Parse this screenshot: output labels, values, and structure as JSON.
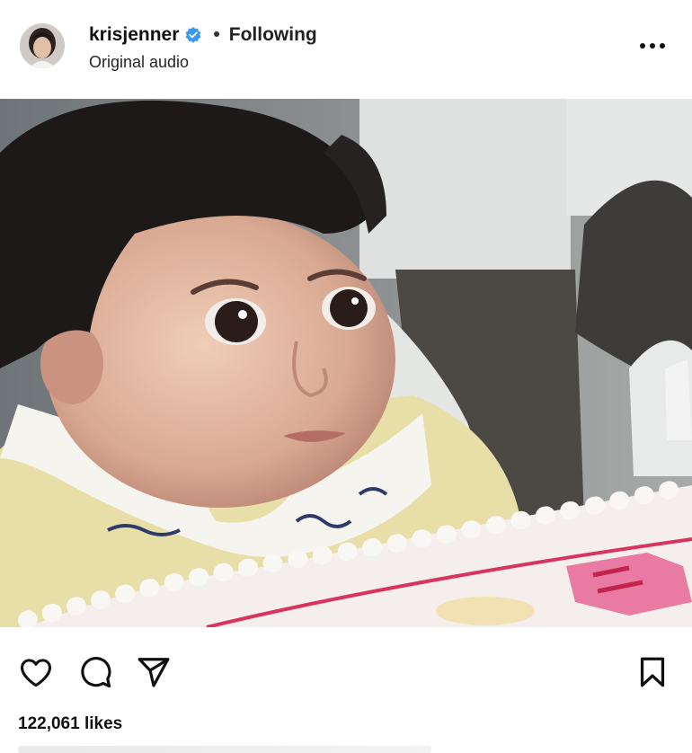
{
  "post": {
    "username": "krisjenner",
    "follow_status": "Following",
    "separator": "•",
    "subtitle": "Original audio",
    "likes_text": "122,061 likes"
  },
  "icons": {
    "verified": "verified-badge-icon",
    "more": "more-options-icon",
    "like": "heart-icon",
    "comment": "comment-icon",
    "share": "share-icon",
    "save": "bookmark-icon"
  },
  "colors": {
    "verified_blue": "#3897f0",
    "text": "#111111",
    "background": "#ffffff"
  }
}
